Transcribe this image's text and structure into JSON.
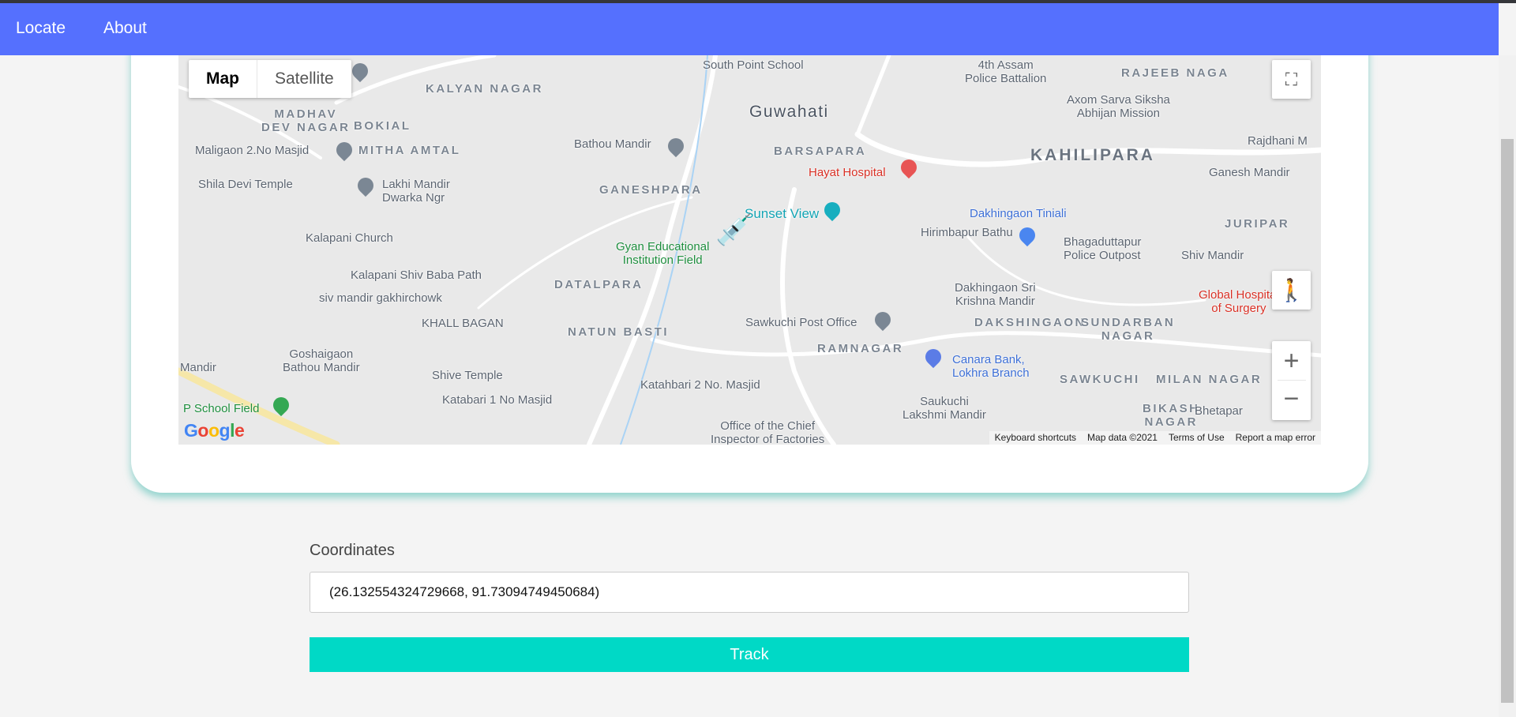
{
  "nav": {
    "items": [
      {
        "label": "Locate"
      },
      {
        "label": "About"
      }
    ],
    "color": "#5570fe"
  },
  "map": {
    "type_controls": {
      "map": "Map",
      "satellite": "Satellite",
      "selected": "Map"
    },
    "labels": [
      "KALYAN NAGAR",
      "MADHAV\nDEV NAGAR",
      "BOKIAL",
      "MITHA AMTAL",
      "Maligaon 2.No Masjid",
      "Shila Devi Temple",
      "Lakhi Mandir\nDwarka Ngr",
      "GANESHPARA",
      "Bathou Mandir",
      "Guwahati",
      "South Point School",
      "4th Assam\nPolice Battalion",
      "BARSAPARA",
      "Hayat Hospital",
      "KAHILIPARA",
      "RAJEEB NAGA",
      "Axom Sarva Siksha\nAbhijan Mission",
      "Rajdhani M",
      "Ganesh Mandir",
      "Sunset View",
      "Dakhingaon Tiniali",
      "JURIPAR",
      "Hirimbapur Bathu",
      "Bhagaduttapur\nPolice Outpost",
      "Shiv Mandir",
      "Kalapani Church",
      "Gyan Educational\nInstitution Field",
      "Kalapani Shiv Baba Path",
      "DATALPARA",
      "Dakhingaon Sri\nKrishna Mandir",
      "Global Hospital\nof Surgery",
      "siv mandir gakhirchowk",
      "KHALL BAGAN",
      "Sawkuchi Post Office",
      "DAKSHINGAON",
      "SUNDARBAN\nNAGAR",
      "NATUN BASTI",
      "RAMNAGAR",
      "Canara Bank,\nLokhra Branch",
      "Goshaigaon\nBathou Mandir",
      "Shive Temple",
      "Katahbari 2 No. Masjid",
      "SAWKUCHI",
      "MILAN NAGAR",
      "Katabari 1 No Masjid",
      "Saukuchi\nLakshmi Mandir",
      "BIKASH\nNAGAR",
      "P School Field",
      "Office of the Chief\nInspector of Factories",
      "Mandir",
      "Bhetapar"
    ],
    "marker_icon": "vaccine-syringe-icon",
    "logo": "Google",
    "attribution": [
      "Keyboard shortcuts",
      "Map data ©2021",
      "Terms of Use",
      "Report a map error"
    ]
  },
  "form": {
    "label": "Coordinates",
    "value": "(26.132554324729668, 91.73094749450684)",
    "button": "Track",
    "button_color": "#00d9c6"
  }
}
